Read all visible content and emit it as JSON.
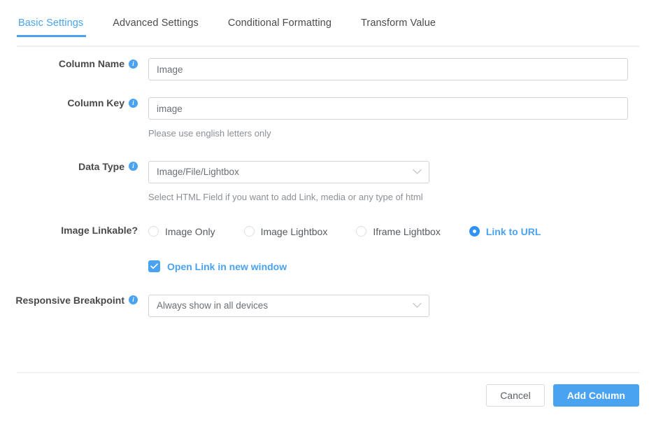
{
  "theme": {
    "accent": "#4aa3f0",
    "label_color": "#4a4a4a",
    "hint_color": "#8b9096",
    "border_color": "#cfd4d8"
  },
  "tabs": [
    {
      "label": "Basic Settings",
      "active": true
    },
    {
      "label": "Advanced Settings",
      "active": false
    },
    {
      "label": "Conditional Formatting",
      "active": false
    },
    {
      "label": "Transform Value",
      "active": false
    }
  ],
  "form": {
    "column_name": {
      "label": "Column Name",
      "info_icon": "info-icon",
      "value": "Image",
      "placeholder": "Column Name"
    },
    "column_key": {
      "label": "Column Key",
      "info_icon": "info-icon",
      "value": "image",
      "placeholder": "Column Key",
      "hint": "Please use english letters only"
    },
    "data_type": {
      "label": "Data Type",
      "info_icon": "info-icon",
      "selected": "Image/File/Lightbox",
      "chevron_icon": "chevron-down-icon",
      "hint": "Select HTML Field if you want to add Link, media or any type of html"
    },
    "image_linkable": {
      "label": "Image Linkable?",
      "options": [
        {
          "label": "Image Only",
          "selected": false
        },
        {
          "label": "Image Lightbox",
          "selected": false
        },
        {
          "label": "Iframe Lightbox",
          "selected": false
        },
        {
          "label": "Link to URL",
          "selected": true
        }
      ]
    },
    "open_link_new_window": {
      "label": "Open Link in new window",
      "checked": true,
      "check_icon": "checkmark-icon"
    },
    "responsive_breakpoint": {
      "label": "Responsive Breakpoint",
      "info_icon": "info-icon",
      "selected": "Always show in all devices",
      "chevron_icon": "chevron-down-icon"
    }
  },
  "footer": {
    "cancel_label": "Cancel",
    "submit_label": "Add Column"
  }
}
